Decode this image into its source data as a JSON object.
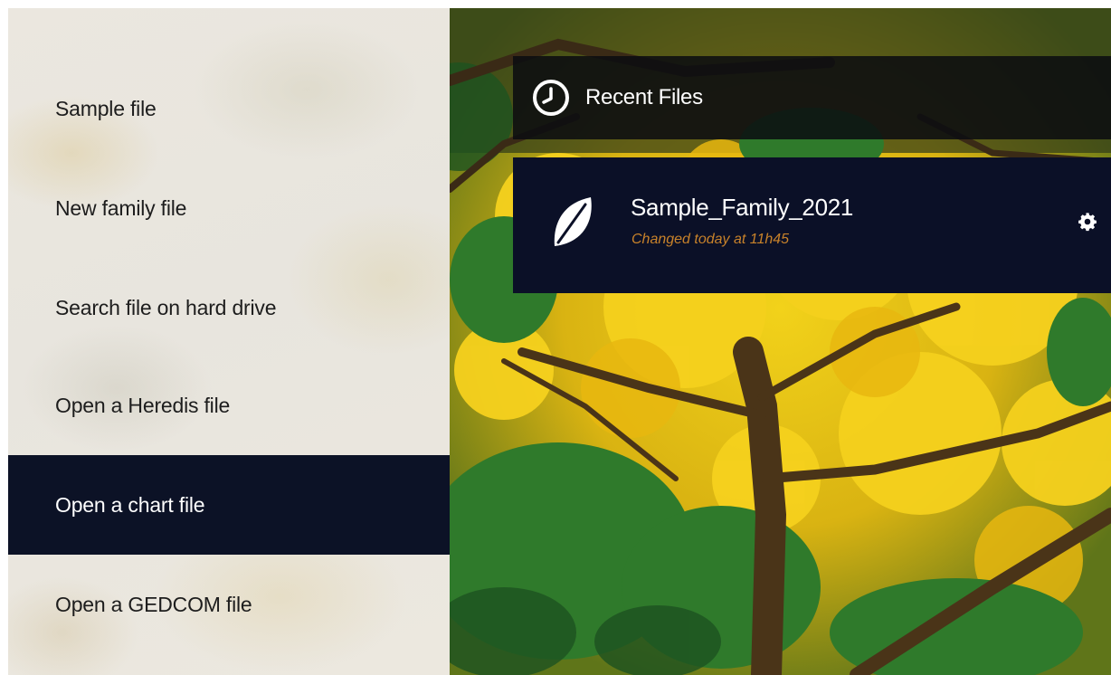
{
  "menu": {
    "items": [
      {
        "label": "Sample file"
      },
      {
        "label": "New family file"
      },
      {
        "label": "Search file on hard drive"
      },
      {
        "label": "Open a Heredis file"
      },
      {
        "label": "Open a chart file",
        "active": true
      },
      {
        "label": "Open a GEDCOM file"
      }
    ]
  },
  "recent": {
    "title": "Recent Files",
    "icon": "clock-icon",
    "files": [
      {
        "name": "Sample_Family_2021",
        "changed": "Changed today at 11h45",
        "icon": "leaf-icon",
        "settings_icon": "gear-icon"
      }
    ]
  },
  "colors": {
    "active_bg": "#0c1226",
    "card_bg": "#0b1027",
    "date_text": "#c8822a"
  }
}
